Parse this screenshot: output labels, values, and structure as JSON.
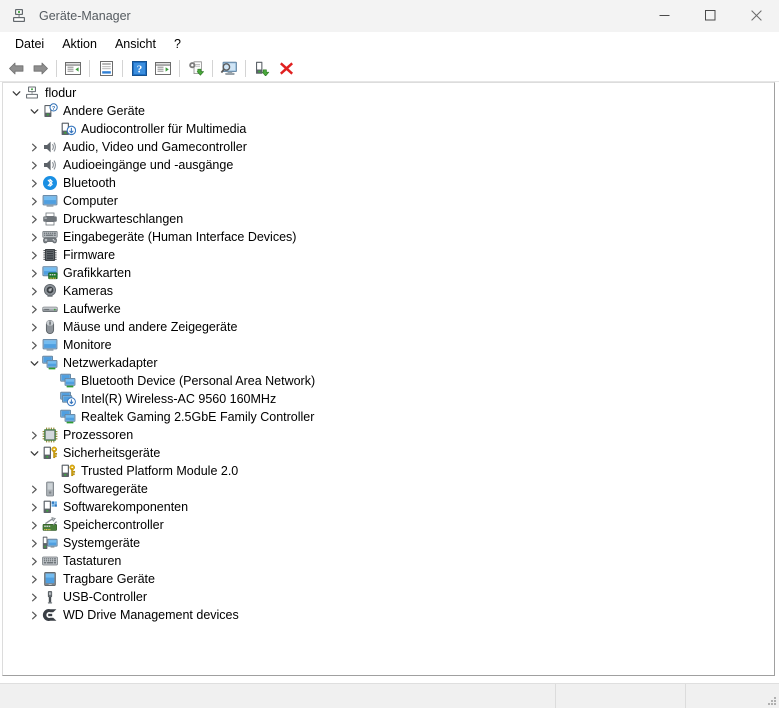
{
  "window": {
    "title": "Geräte-Manager",
    "icon": "device-manager-icon",
    "minimize_label": "—",
    "maximize_label": "□",
    "close_label": "✕"
  },
  "menubar": {
    "items": [
      {
        "label": "Datei",
        "name": "menu-datei"
      },
      {
        "label": "Aktion",
        "name": "menu-aktion"
      },
      {
        "label": "Ansicht",
        "name": "menu-ansicht"
      },
      {
        "label": "?",
        "name": "menu-help"
      }
    ]
  },
  "toolbar": {
    "buttons": [
      {
        "name": "back-button",
        "icon": "arrow-left-icon",
        "tooltip": "Zurück"
      },
      {
        "name": "forward-button",
        "icon": "arrow-right-icon",
        "tooltip": "Vorwärts"
      },
      {
        "name": "separator-1",
        "icon": "separator",
        "tooltip": ""
      },
      {
        "name": "show-hide-console-tree-button",
        "icon": "console-tree-icon",
        "tooltip": "Konsolenstruktur ein-/ausblenden"
      },
      {
        "name": "separator-2",
        "icon": "separator",
        "tooltip": ""
      },
      {
        "name": "properties-button",
        "icon": "properties-icon",
        "tooltip": "Eigenschaften"
      },
      {
        "name": "separator-3",
        "icon": "separator",
        "tooltip": ""
      },
      {
        "name": "help-button",
        "icon": "help-question-icon",
        "tooltip": "Hilfe"
      },
      {
        "name": "show-hide-action-pane-button",
        "icon": "action-pane-icon",
        "tooltip": "Aktionsbereich ein-/ausblenden"
      },
      {
        "name": "separator-4",
        "icon": "separator",
        "tooltip": ""
      },
      {
        "name": "update-driver-button",
        "icon": "update-driver-icon",
        "tooltip": "Treiber aktualisieren"
      },
      {
        "name": "separator-5",
        "icon": "separator",
        "tooltip": ""
      },
      {
        "name": "scan-hardware-changes-button",
        "icon": "scan-monitor-icon",
        "tooltip": "Nach geänderter Hardware suchen"
      },
      {
        "name": "separator-6",
        "icon": "separator",
        "tooltip": ""
      },
      {
        "name": "enable-device-button",
        "icon": "enable-device-icon",
        "tooltip": "Gerät aktivieren"
      },
      {
        "name": "uninstall-device-button",
        "icon": "uninstall-red-x-icon",
        "tooltip": "Gerät deinstallieren"
      }
    ]
  },
  "tree": {
    "nodes": [
      {
        "label": "flodur",
        "level": 0,
        "state": "expanded",
        "icon": "computer-node-icon"
      },
      {
        "label": "Andere Geräte",
        "level": 1,
        "state": "expanded",
        "icon": "unknown-device-icon"
      },
      {
        "label": "Audiocontroller für Multimedia",
        "level": 2,
        "state": "leaf",
        "icon": "unknown-device-warning-icon"
      },
      {
        "label": "Audio, Video und Gamecontroller",
        "level": 1,
        "state": "collapsed",
        "icon": "speaker-icon"
      },
      {
        "label": "Audioeingänge und -ausgänge",
        "level": 1,
        "state": "collapsed",
        "icon": "speaker-icon"
      },
      {
        "label": "Bluetooth",
        "level": 1,
        "state": "collapsed",
        "icon": "bluetooth-icon"
      },
      {
        "label": "Computer",
        "level": 1,
        "state": "collapsed",
        "icon": "monitor-icon"
      },
      {
        "label": "Druckwarteschlangen",
        "level": 1,
        "state": "collapsed",
        "icon": "printer-icon"
      },
      {
        "label": "Eingabegeräte (Human Interface Devices)",
        "level": 1,
        "state": "collapsed",
        "icon": "hid-keyboard-gamepad-icon"
      },
      {
        "label": "Firmware",
        "level": 1,
        "state": "collapsed",
        "icon": "firmware-chip-icon"
      },
      {
        "label": "Grafikkarten",
        "level": 1,
        "state": "collapsed",
        "icon": "display-adapter-icon"
      },
      {
        "label": "Kameras",
        "level": 1,
        "state": "collapsed",
        "icon": "camera-icon"
      },
      {
        "label": "Laufwerke",
        "level": 1,
        "state": "collapsed",
        "icon": "disk-drive-icon"
      },
      {
        "label": "Mäuse und andere Zeigegeräte",
        "level": 1,
        "state": "collapsed",
        "icon": "mouse-icon"
      },
      {
        "label": "Monitore",
        "level": 1,
        "state": "collapsed",
        "icon": "monitor-icon"
      },
      {
        "label": "Netzwerkadapter",
        "level": 1,
        "state": "expanded",
        "icon": "network-adapter-icon"
      },
      {
        "label": "Bluetooth Device (Personal Area Network)",
        "level": 2,
        "state": "leaf",
        "icon": "network-adapter-icon"
      },
      {
        "label": "Intel(R) Wireless-AC 9560 160MHz",
        "level": 2,
        "state": "leaf",
        "icon": "wireless-adapter-icon"
      },
      {
        "label": "Realtek Gaming 2.5GbE Family Controller",
        "level": 2,
        "state": "leaf",
        "icon": "network-adapter-icon"
      },
      {
        "label": "Prozessoren",
        "level": 1,
        "state": "collapsed",
        "icon": "processor-icon"
      },
      {
        "label": "Sicherheitsgeräte",
        "level": 1,
        "state": "expanded",
        "icon": "security-device-key-icon"
      },
      {
        "label": "Trusted Platform Module 2.0",
        "level": 2,
        "state": "leaf",
        "icon": "security-device-key-icon"
      },
      {
        "label": "Softwaregeräte",
        "level": 1,
        "state": "collapsed",
        "icon": "software-device-icon"
      },
      {
        "label": "Softwarekomponenten",
        "level": 1,
        "state": "collapsed",
        "icon": "software-component-icon"
      },
      {
        "label": "Speichercontroller",
        "level": 1,
        "state": "collapsed",
        "icon": "storage-controller-icon"
      },
      {
        "label": "Systemgeräte",
        "level": 1,
        "state": "collapsed",
        "icon": "system-device-icon"
      },
      {
        "label": "Tastaturen",
        "level": 1,
        "state": "collapsed",
        "icon": "keyboard-icon"
      },
      {
        "label": "Tragbare Geräte",
        "level": 1,
        "state": "collapsed",
        "icon": "portable-device-icon"
      },
      {
        "label": "USB-Controller",
        "level": 1,
        "state": "collapsed",
        "icon": "usb-icon"
      },
      {
        "label": "WD Drive Management devices",
        "level": 1,
        "state": "collapsed",
        "icon": "wd-logo-icon"
      }
    ]
  },
  "statusbar": {
    "panel1": "",
    "panel2": "",
    "panel3": ""
  },
  "colors": {
    "titlebar_bg": "#f3f3f3",
    "accent_blue": "#0f7bd4",
    "uninstall_red": "#e02020",
    "selection_blue": "#cce8ff"
  }
}
